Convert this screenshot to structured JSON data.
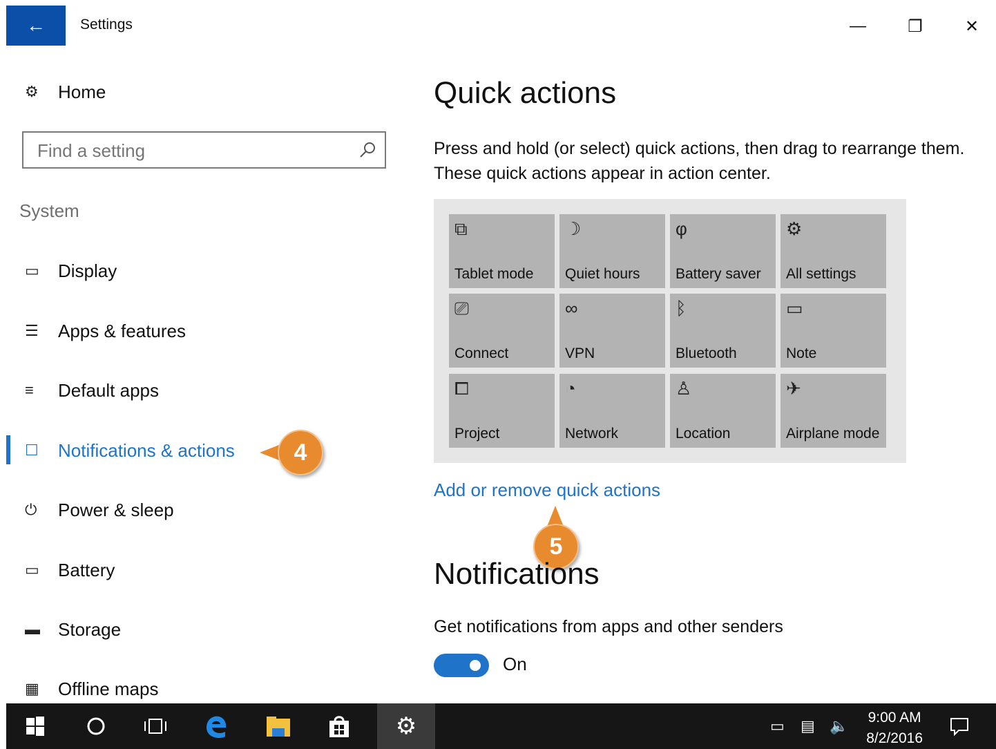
{
  "window": {
    "title": "Settings",
    "back_icon": "back-arrow-icon",
    "minimize_glyph": "—",
    "restore_glyph": "❐",
    "close_glyph": "✕"
  },
  "sidebar": {
    "home_label": "Home",
    "search_placeholder": "Find a setting",
    "section_label": "System",
    "items": [
      {
        "label": "Display",
        "icon": "monitor-icon"
      },
      {
        "label": "Apps & features",
        "icon": "list-icon"
      },
      {
        "label": "Default apps",
        "icon": "default-apps-icon"
      },
      {
        "label": "Notifications & actions",
        "icon": "notification-icon",
        "selected": true
      },
      {
        "label": "Power & sleep",
        "icon": "power-icon"
      },
      {
        "label": "Battery",
        "icon": "battery-icon"
      },
      {
        "label": "Storage",
        "icon": "storage-icon"
      },
      {
        "label": "Offline maps",
        "icon": "map-icon"
      }
    ]
  },
  "main": {
    "quick_actions_title": "Quick actions",
    "quick_actions_desc": "Press and hold (or select) quick actions, then drag to rearrange them. These quick actions appear in action center.",
    "tiles": [
      {
        "label": "Tablet mode",
        "icon": "tablet-mode-icon",
        "glyph": "⧉"
      },
      {
        "label": "Quiet hours",
        "icon": "moon-icon",
        "glyph": "☽"
      },
      {
        "label": "Battery saver",
        "icon": "leaf-icon",
        "glyph": "φ"
      },
      {
        "label": "All settings",
        "icon": "gear-icon",
        "glyph": "⚙"
      },
      {
        "label": "Connect",
        "icon": "connect-icon",
        "glyph": "⎚"
      },
      {
        "label": "VPN",
        "icon": "vpn-icon",
        "glyph": "∞"
      },
      {
        "label": "Bluetooth",
        "icon": "bluetooth-icon",
        "glyph": "ᛒ"
      },
      {
        "label": "Note",
        "icon": "note-icon",
        "glyph": "▭"
      },
      {
        "label": "Project",
        "icon": "project-icon",
        "glyph": "⧠"
      },
      {
        "label": "Network",
        "icon": "network-icon",
        "glyph": "◔"
      },
      {
        "label": "Location",
        "icon": "location-icon",
        "glyph": "♙"
      },
      {
        "label": "Airplane mode",
        "icon": "airplane-icon",
        "glyph": "✈"
      }
    ],
    "add_remove_link": "Add or remove quick actions",
    "notifications_title": "Notifications",
    "notifications_desc": "Get notifications from apps and other senders",
    "toggle_state": "On"
  },
  "callouts": {
    "step4": "4",
    "step5": "5"
  },
  "taskbar": {
    "time": "9:00 AM",
    "date": "8/2/2016",
    "accent_color": "#1f73c8"
  }
}
